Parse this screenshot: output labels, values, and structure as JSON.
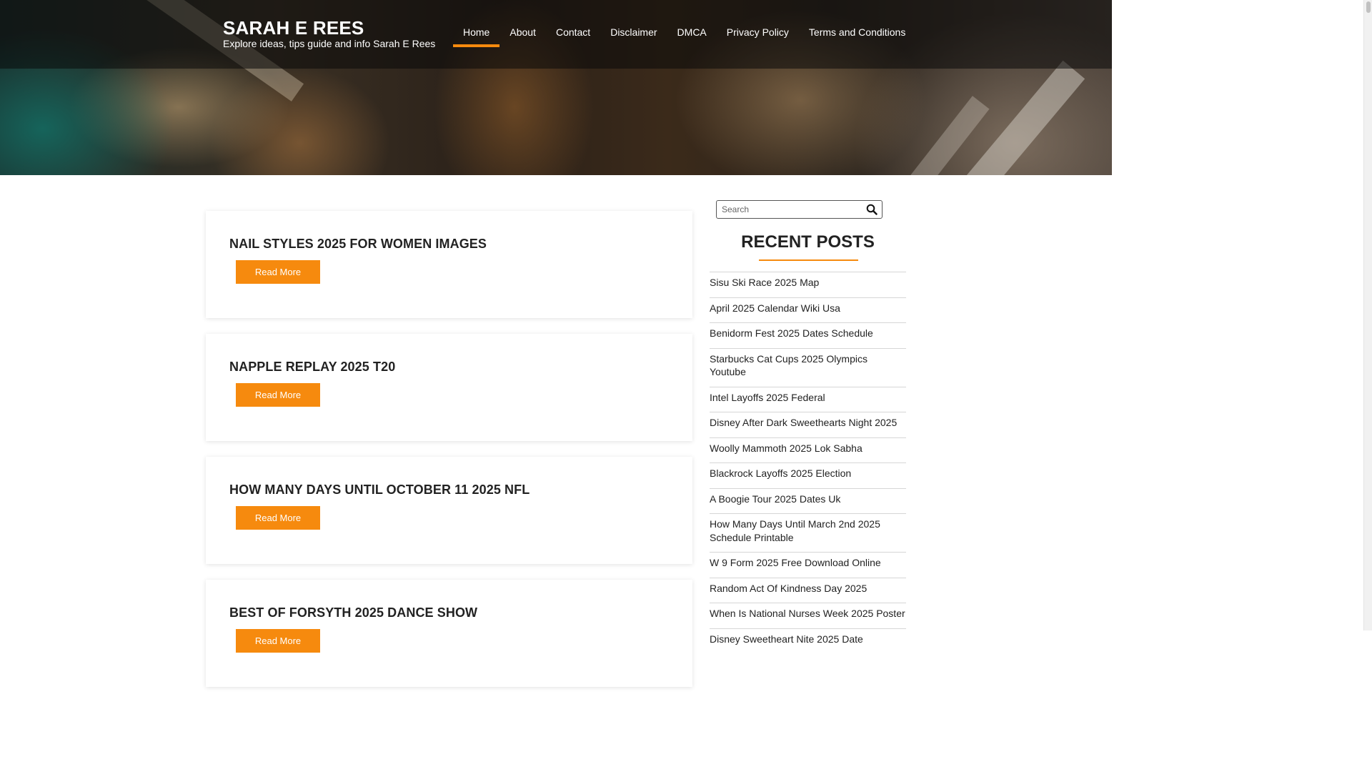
{
  "header": {
    "site_title": "SARAH E REES",
    "site_description": "Explore ideas, tips guide and info Sarah E Rees"
  },
  "nav": {
    "items": [
      {
        "label": "Home",
        "active": true
      },
      {
        "label": "About"
      },
      {
        "label": "Contact"
      },
      {
        "label": "Disclaimer"
      },
      {
        "label": "DMCA"
      },
      {
        "label": "Privacy Policy"
      },
      {
        "label": "Terms and Conditions"
      }
    ]
  },
  "posts": [
    {
      "title": "NAIL STYLES 2025 FOR WOMEN IMAGES",
      "button": "Read More"
    },
    {
      "title": "NAPPLE REPLAY 2025 T20",
      "button": "Read More"
    },
    {
      "title": "HOW MANY DAYS UNTIL OCTOBER 11 2025 NFL",
      "button": "Read More"
    },
    {
      "title": "BEST OF FORSYTH 2025 DANCE SHOW",
      "button": "Read More"
    }
  ],
  "sidebar": {
    "search_placeholder": "Search",
    "recent_posts_title": "RECENT POSTS",
    "recent_posts": [
      "Sisu Ski Race 2025 Map",
      "April 2025 Calendar Wiki Usa",
      "Benidorm Fest 2025 Dates Schedule",
      "Starbucks Cat Cups 2025 Olympics Youtube",
      "Intel Layoffs 2025 Federal",
      "Disney After Dark Sweethearts Night 2025",
      "Woolly Mammoth 2025 Lok Sabha",
      "Blackrock Layoffs 2025 Election",
      "A Boogie Tour 2025 Dates Uk",
      "How Many Days Until March 2nd 2025 Schedule Printable",
      "W 9 Form 2025 Free Download Online",
      "Random Act Of Kindness Day 2025",
      "When Is National Nurses Week 2025 Poster",
      "Disney Sweetheart Nite 2025 Date"
    ]
  },
  "colors": {
    "accent": "#f68a0e",
    "header_overlay": "#1a1a1a",
    "text": "#222222"
  }
}
